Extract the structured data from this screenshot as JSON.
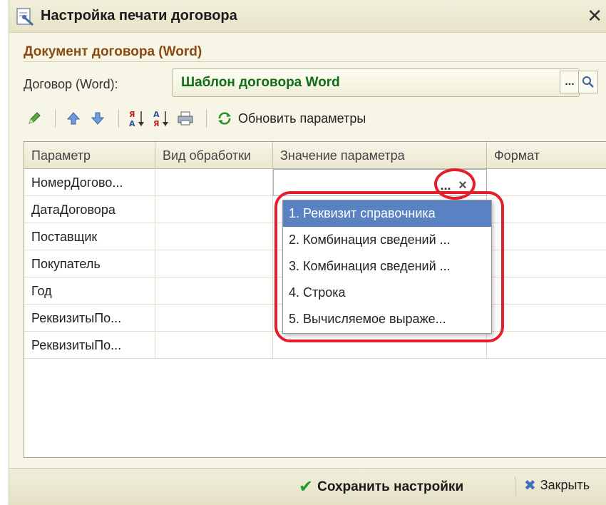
{
  "window": {
    "title": "Настройка печати договора",
    "close_glyph": "✕"
  },
  "section": {
    "title": "Документ договора (Word)"
  },
  "field": {
    "label": "Договор (Word):",
    "value": "Шаблон договора Word",
    "dots_label": "...",
    "search_icon": "magnifier-icon"
  },
  "toolbar": {
    "items": [
      "pencil-icon",
      "arrow-up-icon",
      "arrow-down-icon",
      "sort-asc-icon",
      "sort-desc-icon",
      "print-icon"
    ],
    "refresh_label": "Обновить параметры"
  },
  "grid": {
    "columns": [
      "Параметр",
      "Вид обработки",
      "Значение параметра",
      "Формат"
    ],
    "rows": [
      {
        "param": "НомерДогово...",
        "kind": "",
        "value": "",
        "format": ""
      },
      {
        "param": "ДатаДоговора",
        "kind": "",
        "value": "",
        "format": ""
      },
      {
        "param": "Поставщик",
        "kind": "",
        "value": "",
        "format": ""
      },
      {
        "param": "Покупатель",
        "kind": "",
        "value": "",
        "format": ""
      },
      {
        "param": "Год",
        "kind": "",
        "value": "",
        "format": ""
      },
      {
        "param": "РеквизитыПо...",
        "kind": "",
        "value": "",
        "format": ""
      },
      {
        "param": "РеквизитыПо...",
        "kind": "",
        "value": "",
        "format": ""
      }
    ],
    "edit_dots": "...",
    "edit_clear": "×"
  },
  "dropdown": {
    "items": [
      "1. Реквизит справочника",
      "2. Комбинация сведений ...",
      "3. Комбинация сведений ...",
      "4. Строка",
      "5. Вычисляемое выраже..."
    ],
    "selected_index": 0
  },
  "footer": {
    "save_label": "Сохранить настройки",
    "close_label": "Закрыть"
  },
  "colors": {
    "accent_green": "#0f6e18",
    "section_brown": "#8a4a12",
    "highlight_red": "#e41f2b",
    "selection_blue": "#5a82c2"
  }
}
